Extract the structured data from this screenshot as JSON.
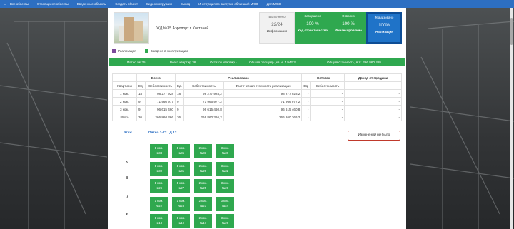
{
  "nav": {
    "items": [
      "Все объекты",
      "Строящиеся объекты",
      "Введенные объекты",
      "Создать объект",
      "Видеоинструкции",
      "Выход",
      "Инструкция по выгрузке облигаций МЖО",
      "Для МЖО"
    ]
  },
  "project": {
    "title": "ЖД №35 Аэропорт г. Костаней"
  },
  "stats": [
    {
      "label": "Выполнено",
      "value": "22/24",
      "sub": "Информация"
    },
    {
      "label": "Завершено",
      "value": "100 %",
      "sub": "Ход строительства"
    },
    {
      "label": "Освоено",
      "value": "100 %",
      "sub": "Финансирование"
    },
    {
      "label": "Реализовано",
      "value": "100%",
      "sub": "Реализация"
    }
  ],
  "legend": [
    {
      "label": "Реализация",
      "color": "#7b4a9a"
    },
    {
      "label": "Введено в эксплуатацию",
      "color": "#2fa84f"
    }
  ],
  "summary": {
    "entrance": "Пятно № 35",
    "total_apts": "Всего квартир 36",
    "remaining": "Остаток квартир -",
    "area": "Общая площадь, кв.м. 1 942,3",
    "cost": "Общая стоимость, в тг. 266 860 368"
  },
  "table": {
    "group_headers": [
      "Всего",
      "Реализовано",
      "Остаток",
      "Доход от продажи"
    ],
    "col_headers": [
      "Квартиры",
      "Ед.",
      "Себестоимость",
      "Ед.",
      "Себестоимость",
      "Фактическая стоимость реализации",
      "Ед.",
      "Себестоимость"
    ],
    "rows": [
      [
        "1 ком.",
        "18",
        "98 277 928",
        "18",
        "98 277 928,2",
        "98 277 928,2",
        "-",
        "-",
        "-"
      ],
      [
        "2 ком.",
        "9",
        "71 966 977",
        "9",
        "71 966 977,2",
        "71 966 977,2",
        "-",
        "-",
        "-"
      ],
      [
        "3 ком.",
        "9",
        "96 615 460",
        "9",
        "96 615 460,8",
        "96 615 460,8",
        "-",
        "-",
        "-"
      ],
      [
        "Итого",
        "36",
        "266 860 366",
        "36",
        "266 860 366,2",
        "266 860 366,2",
        "-",
        "-",
        "-"
      ]
    ]
  },
  "floors": {
    "floor_header": "Этаж",
    "entrance_header": "Пятно 1-72 / Д 12",
    "no_change": "Изменений не было",
    "rows": [
      {
        "floor": "9",
        "apts": [
          [
            "1 ком.",
            "№34"
          ],
          [
            "1 ком.",
            "№35"
          ],
          [
            "2 ком.",
            "№33"
          ],
          [
            "3 ком.",
            "№36"
          ]
        ],
        "label_row": 1
      },
      {
        "floor": "",
        "apts": [
          [
            "1 ком.",
            "№30"
          ],
          [
            "1 ком.",
            "№31"
          ],
          [
            "2 ком.",
            "№29"
          ],
          [
            "3 ком.",
            "№32"
          ]
        ]
      },
      {
        "floor": "8",
        "apts": [
          [
            "1 ком.",
            "№26"
          ],
          [
            "1 ком.",
            "№27"
          ],
          [
            "2 ком.",
            "№25"
          ],
          [
            "3 ком.",
            "№28"
          ]
        ]
      },
      {
        "floor": "7",
        "apts": [
          [
            "1 ком.",
            "№22"
          ],
          [
            "1 ком.",
            "№23"
          ],
          [
            "2 ком.",
            "№21"
          ],
          [
            "3 ком.",
            "№24"
          ]
        ]
      },
      {
        "floor": "6",
        "apts": [
          [
            "1 ком.",
            "№18"
          ],
          [
            "1 ком.",
            "№19"
          ],
          [
            "2 ком.",
            "№17"
          ],
          [
            "3 ком.",
            "№20"
          ]
        ]
      }
    ]
  }
}
